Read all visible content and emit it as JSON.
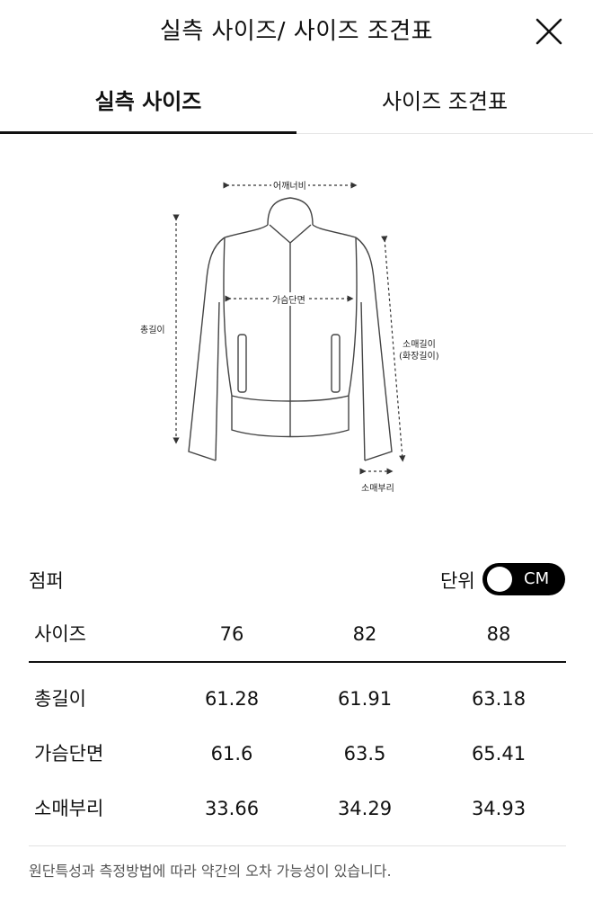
{
  "header": {
    "title": "실측 사이즈/ 사이즈 조견표",
    "close_icon": "close-icon"
  },
  "tabs": [
    {
      "label": "실측 사이즈",
      "active": true
    },
    {
      "label": "사이즈 조견표",
      "active": false
    }
  ],
  "diagram": {
    "labels": {
      "shoulder": "어깨너비",
      "chest": "가슴단면",
      "total_length": "총길이",
      "sleeve_length": "소매길이",
      "sleeve_length_sub": "(화장길이)",
      "cuff": "소매부리"
    }
  },
  "product": {
    "name": "점퍼"
  },
  "unit": {
    "label": "단위",
    "value": "CM",
    "toggle_color": "#000000"
  },
  "size_table": {
    "header": {
      "label": "사이즈",
      "sizes": [
        "76",
        "82",
        "88"
      ]
    },
    "rows": [
      {
        "label": "총길이",
        "values": [
          "61.28",
          "61.91",
          "63.18"
        ]
      },
      {
        "label": "가슴단면",
        "values": [
          "61.6",
          "63.5",
          "65.41"
        ]
      },
      {
        "label": "소매부리",
        "values": [
          "33.66",
          "34.29",
          "34.93"
        ]
      }
    ]
  },
  "disclaimer": "원단특성과 측정방법에 따라 약간의 오차 가능성이 있습니다."
}
